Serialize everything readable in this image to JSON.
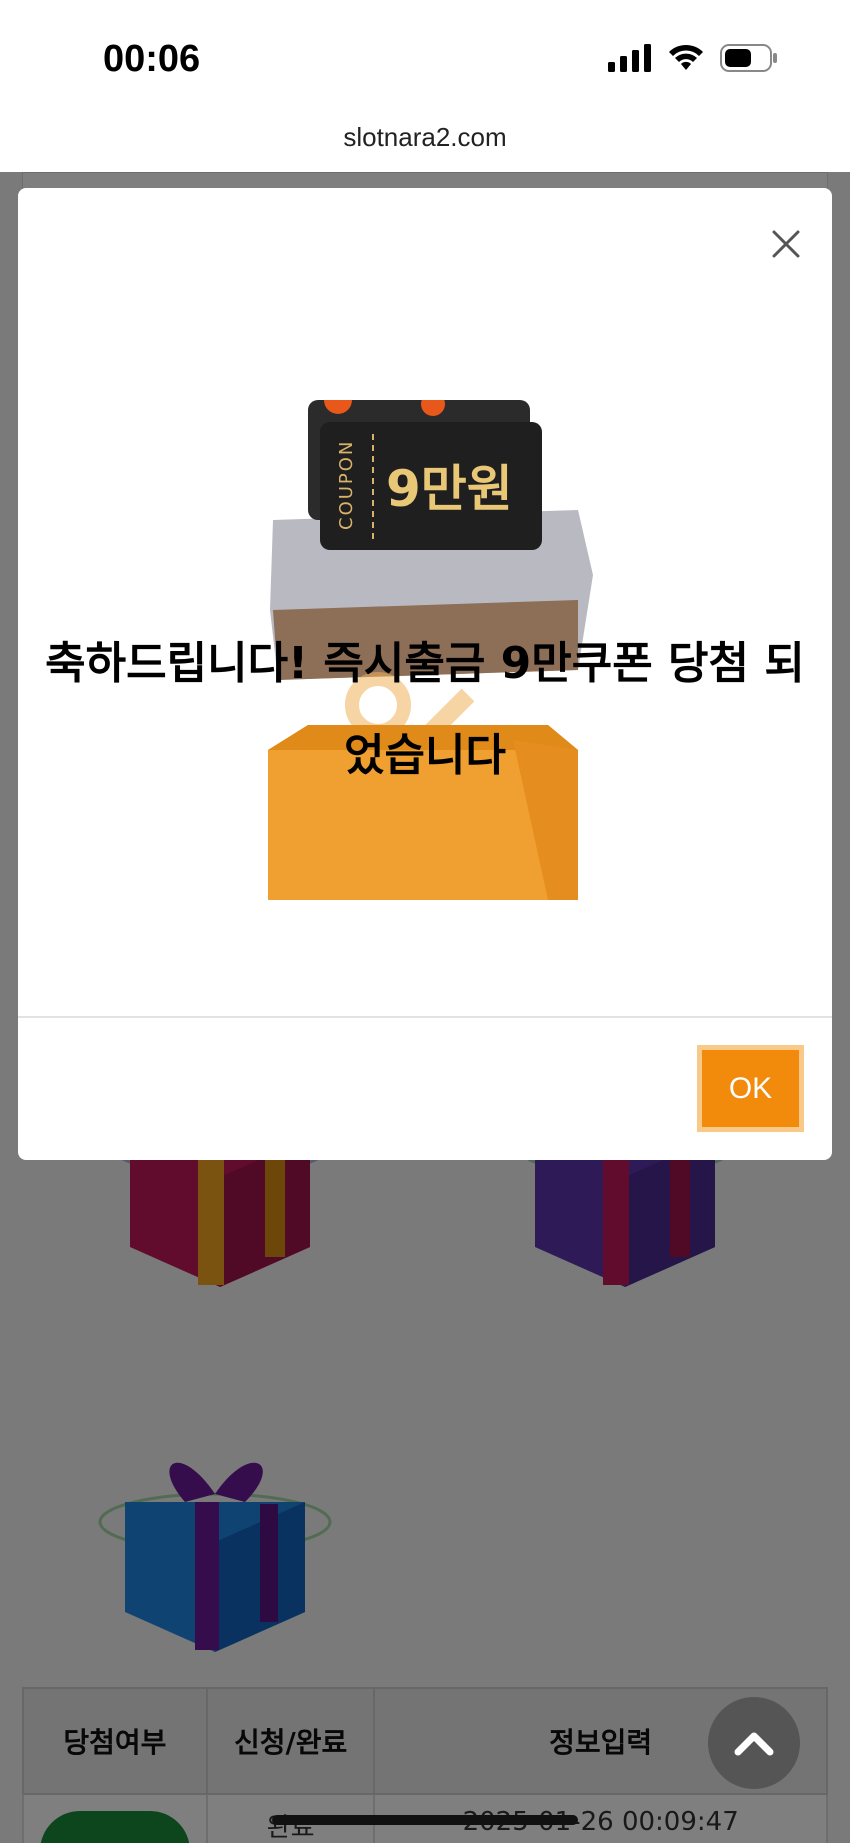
{
  "status_bar": {
    "time": "00:06",
    "icons": [
      "cellular-signal-icon",
      "wifi-icon",
      "battery-icon"
    ]
  },
  "browser": {
    "url": "slotnara2.com"
  },
  "modal": {
    "coupon_label": "COUPON",
    "coupon_amount": "9만원",
    "message": "축하드립니다! 즉시출금 9만쿠폰 당첨 되었습니다",
    "ok_label": "OK",
    "close_icon": "close-icon"
  },
  "result_table": {
    "headers": [
      "당첨여부",
      "신청/완료",
      "정보입력"
    ],
    "row": {
      "status": "완료",
      "datetime": "2025-01-26 00:09:47"
    }
  },
  "colors": {
    "ok_button": "#f28a0c",
    "overlay": "rgba(0,0,0,0.5)",
    "pill": "#1a8a3a"
  }
}
